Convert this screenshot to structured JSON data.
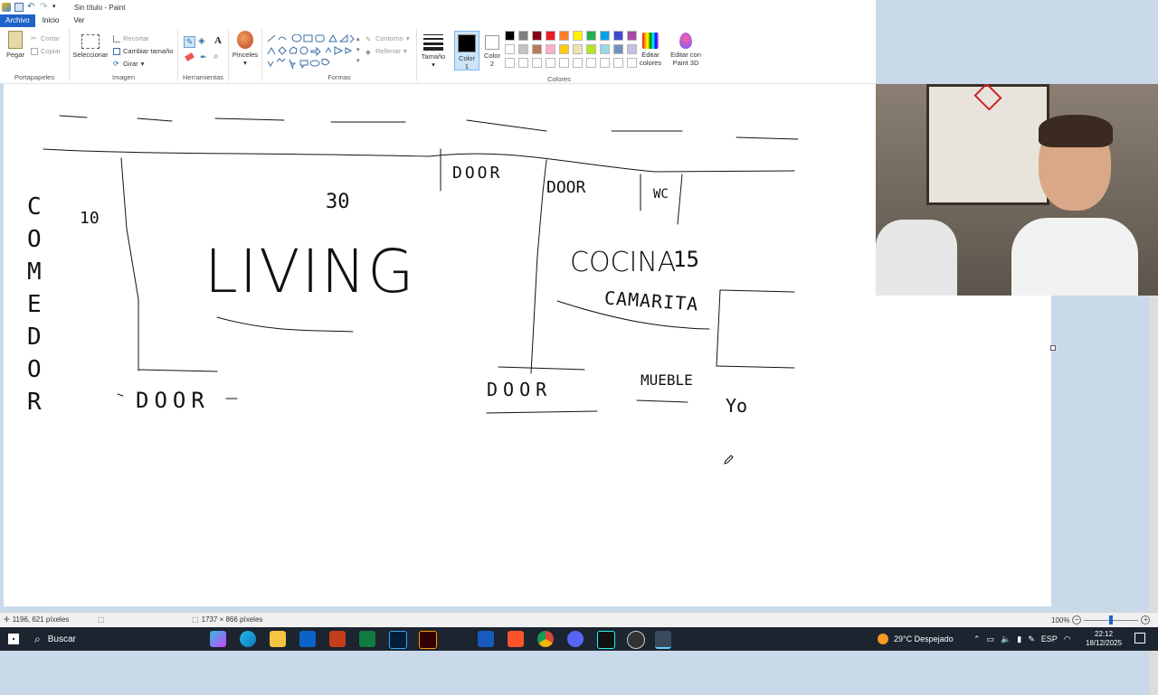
{
  "titlebar": {
    "title": "Sin título - Paint"
  },
  "menu": {
    "file": "Archivo",
    "home": "Inicio",
    "view": "Ver"
  },
  "ribbon": {
    "clipboard": {
      "paste": "Pegar",
      "cut": "Cortar",
      "copy": "Copiar",
      "label": "Portapapeles"
    },
    "image": {
      "select": "Seleccionar",
      "crop": "Recortar",
      "resize": "Cambiar tamaño",
      "rotate": "Girar",
      "label": "Imagen"
    },
    "tools": {
      "label": "Herramientas"
    },
    "brushes": {
      "label": "Pinceles"
    },
    "shapes": {
      "outline": "Contorno",
      "fill": "Rellenar",
      "label": "Formas"
    },
    "size": {
      "label": "Tamaño"
    },
    "color1": {
      "label": "Color",
      "sub": "1"
    },
    "color2": {
      "label": "Color",
      "sub": "2"
    },
    "colors": {
      "label": "Colores"
    },
    "edit_colors": {
      "l1": "Editar",
      "l2": "colores"
    },
    "paint3d": {
      "l1": "Editar con",
      "l2": "Paint 3D"
    }
  },
  "palette": {
    "row1": [
      "#000000",
      "#7f7f7f",
      "#880015",
      "#ed1c24",
      "#ff7f27",
      "#fff200",
      "#22b14c",
      "#00a2e8",
      "#3f48cc",
      "#a349a4"
    ],
    "row2": [
      "#ffffff",
      "#c3c3c3",
      "#b97a57",
      "#ffaec9",
      "#ffc90e",
      "#efe4b0",
      "#b5e61d",
      "#99d9ea",
      "#7092be",
      "#c8bfe7"
    ]
  },
  "canvas_text": {
    "comedor": [
      "C",
      "O",
      "M",
      "E",
      "D",
      "O",
      "R"
    ],
    "door_left": "DOOR",
    "living": "LIVING",
    "door_top1": "DOOR",
    "door_top2": "DOOR",
    "wc": "WC",
    "cocina": "COCINA",
    "note_30": "30",
    "note_15": "15",
    "note_10": "10",
    "camarita": "CAMARITA",
    "door_bottom": "DOOR",
    "mueble": "MUEBLE",
    "yo": "Yo"
  },
  "statusbar": {
    "cursor": "1196, 621 píxeles",
    "size": "1737 × 866 píxeles",
    "zoom": "100%"
  },
  "taskbar": {
    "search": "Buscar",
    "weather": "29°C  Despejado",
    "lang": "ESP",
    "time": "22:12",
    "date": "18/12/2025"
  }
}
